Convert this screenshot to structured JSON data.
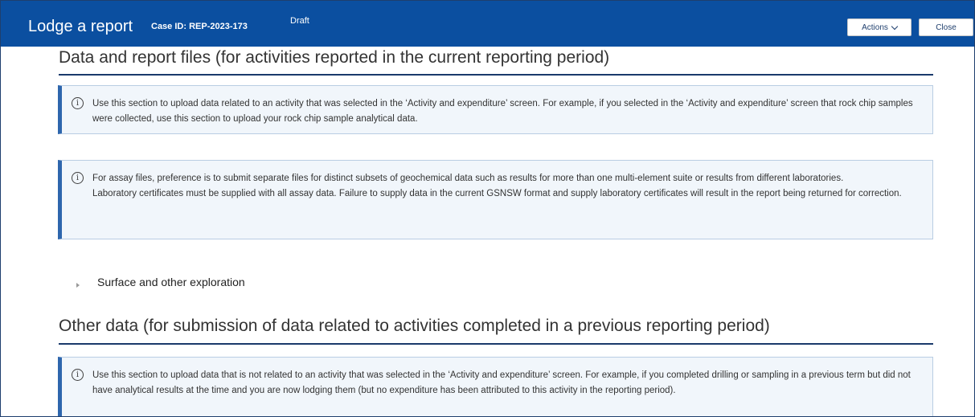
{
  "header": {
    "title": "Lodge a report",
    "case_id": "Case ID: REP-2023-173",
    "status": "Draft",
    "actions_label": "Actions",
    "close_label": "Close",
    "bg_color": "#0b4fa0"
  },
  "section1": {
    "heading": "Data and report files (for activities reported in the current reporting period)",
    "info1": "Use this section to upload data related to an activity that was selected in the ‘Activity and expenditure’ screen. For example, if you selected in the ‘Activity and expenditure’ screen that rock chip samples were collected, use this section to upload your rock chip sample analytical data.",
    "info2_line1": "For assay files, preference is to submit separate files for distinct subsets of geochemical data such as results for more than one multi-element suite or results from different laboratories.",
    "info2_line2": "Laboratory certificates must be supplied with all assay data. Failure to supply data in the current GSNSW format and supply laboratory certificates will result in the report being returned for correction.",
    "expander_label": "Surface and other exploration"
  },
  "section2": {
    "heading": "Other data (for submission of data related to activities completed in a previous reporting period)",
    "info": "Use this section to upload data that is not related to an activity that was selected in the ‘Activity and expenditure’ screen. For example, if you completed drilling or sampling in a previous term but did not have analytical results at the time and you are now lodging them (but no expenditure has been attributed to this activity in the reporting period)."
  },
  "icons": {
    "info": "info-icon",
    "chevron": "chevron-down-icon",
    "expander": "triangle-right-icon"
  }
}
